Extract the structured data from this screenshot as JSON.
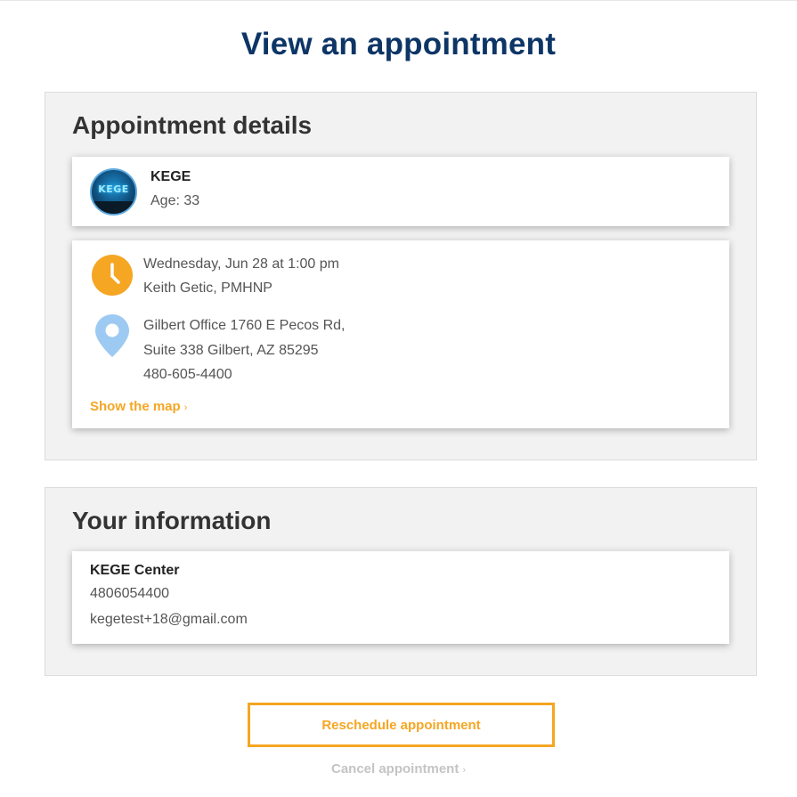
{
  "page": {
    "title": "View an appointment"
  },
  "appointment_details": {
    "heading": "Appointment details",
    "patient": {
      "avatar_text": "KEGE",
      "name": "KEGE",
      "age": "Age: 33"
    },
    "visit": {
      "datetime": "Wednesday, Jun 28 at 1:00 pm",
      "provider": "Keith Getic, PMHNP",
      "location_line1": "Gilbert Office 1760 E Pecos Rd,",
      "location_line2": "Suite 338 Gilbert, AZ 85295",
      "phone": "480-605-4400",
      "map_link": "Show the map",
      "map_link_chevron": "›"
    },
    "icons": {
      "clock": "clock-icon",
      "location": "map-pin-icon"
    }
  },
  "your_information": {
    "heading": "Your information",
    "name": "KEGE Center",
    "phone": "4806054400",
    "email": "kegetest+18@gmail.com"
  },
  "actions": {
    "reschedule_label": "Reschedule appointment",
    "cancel_label": "Cancel appointment",
    "cancel_chevron": "›"
  },
  "colors": {
    "title": "#0d3566",
    "accent": "#f5a623",
    "pin": "#9ccaf2",
    "muted": "#c4c4c4",
    "panel": "#f2f2f2"
  }
}
